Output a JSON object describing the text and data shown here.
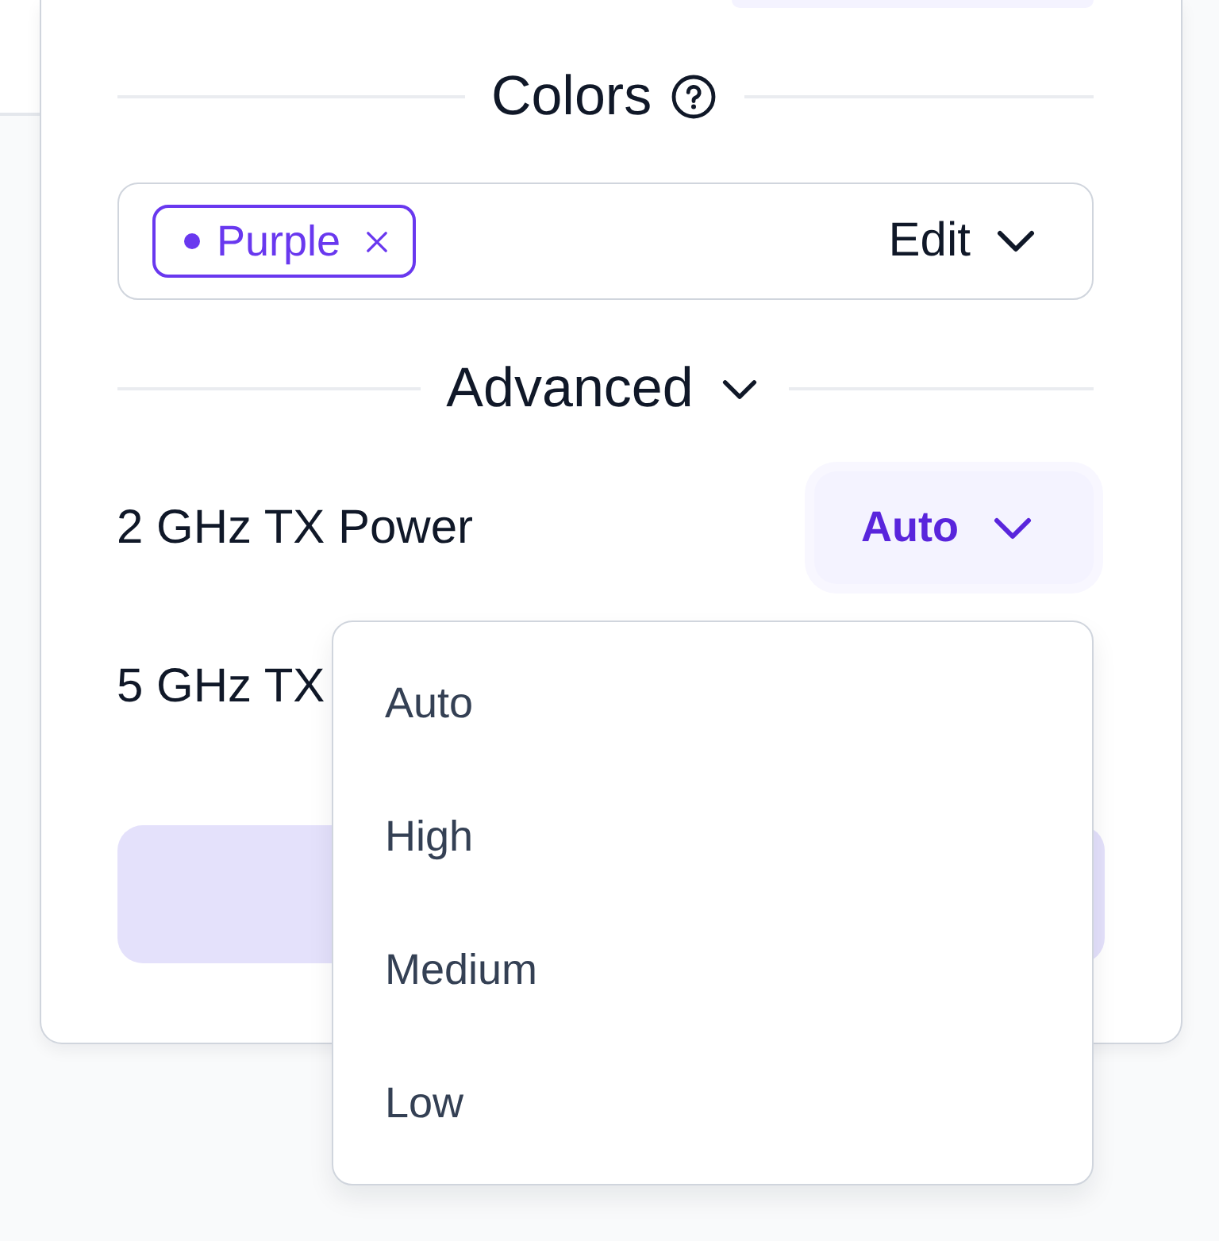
{
  "colors_section": {
    "title": "Colors",
    "tags": [
      {
        "label": "Purple",
        "color": "#6938ef"
      }
    ],
    "edit_label": "Edit"
  },
  "advanced_section": {
    "title": "Advanced",
    "expanded": true
  },
  "settings": [
    {
      "label": "2 GHz TX Power",
      "value": "Auto",
      "open": true,
      "options": [
        "Auto",
        "High",
        "Medium",
        "Low"
      ]
    },
    {
      "label": "5 GHz TX"
    }
  ]
}
